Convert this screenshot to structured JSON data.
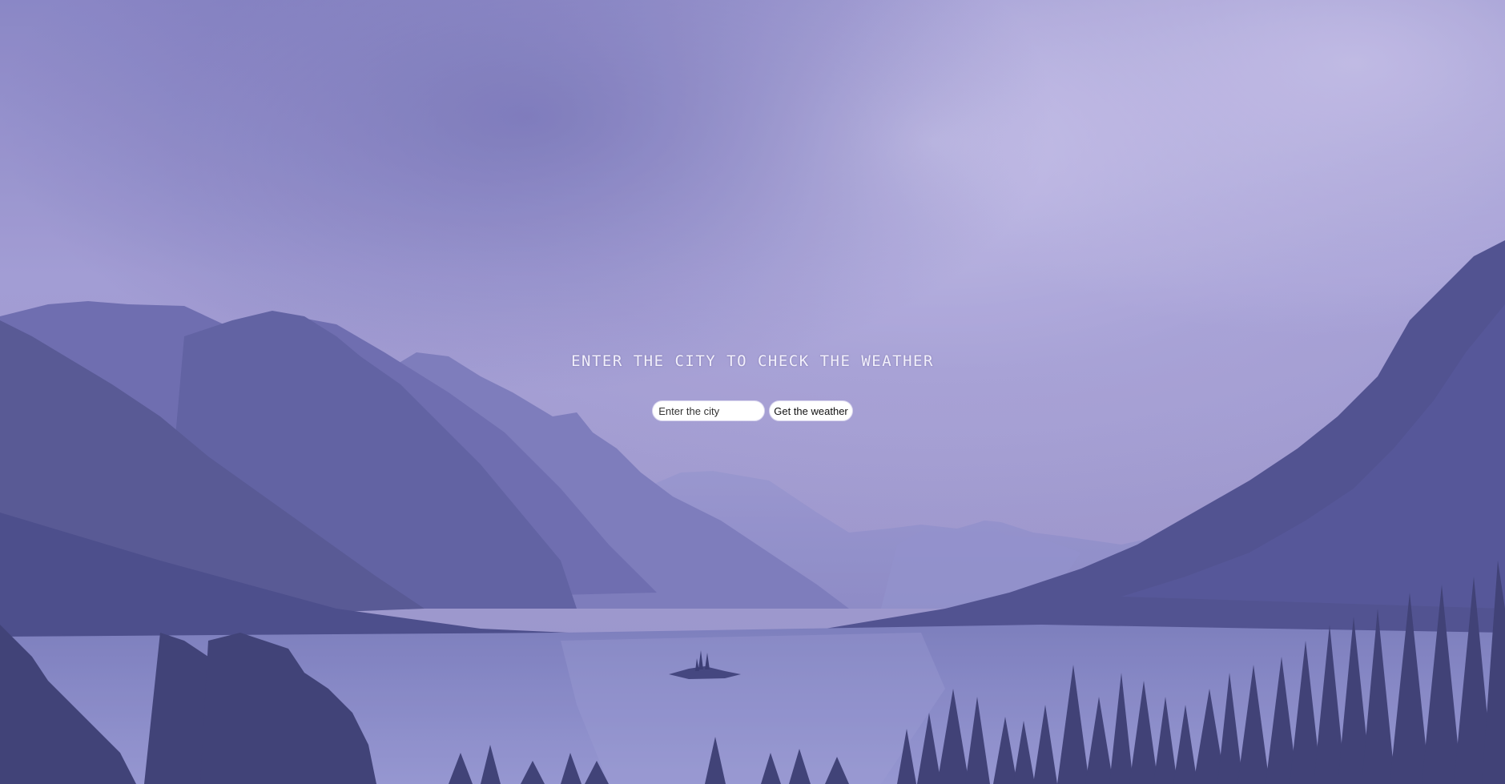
{
  "page": {
    "heading": "ENTER THE CITY TO CHECK THE WEATHER"
  },
  "search": {
    "placeholder": "Enter the city",
    "value": "",
    "button_label": "Get the weather"
  },
  "colors": {
    "overlay_tint": "#7b78c4",
    "sky_light": "#c3bde6",
    "mountain_dark": "#4e4f8c",
    "lake": "#8d8fcc",
    "trees": "#35375f",
    "text": "#f2f0fb"
  }
}
